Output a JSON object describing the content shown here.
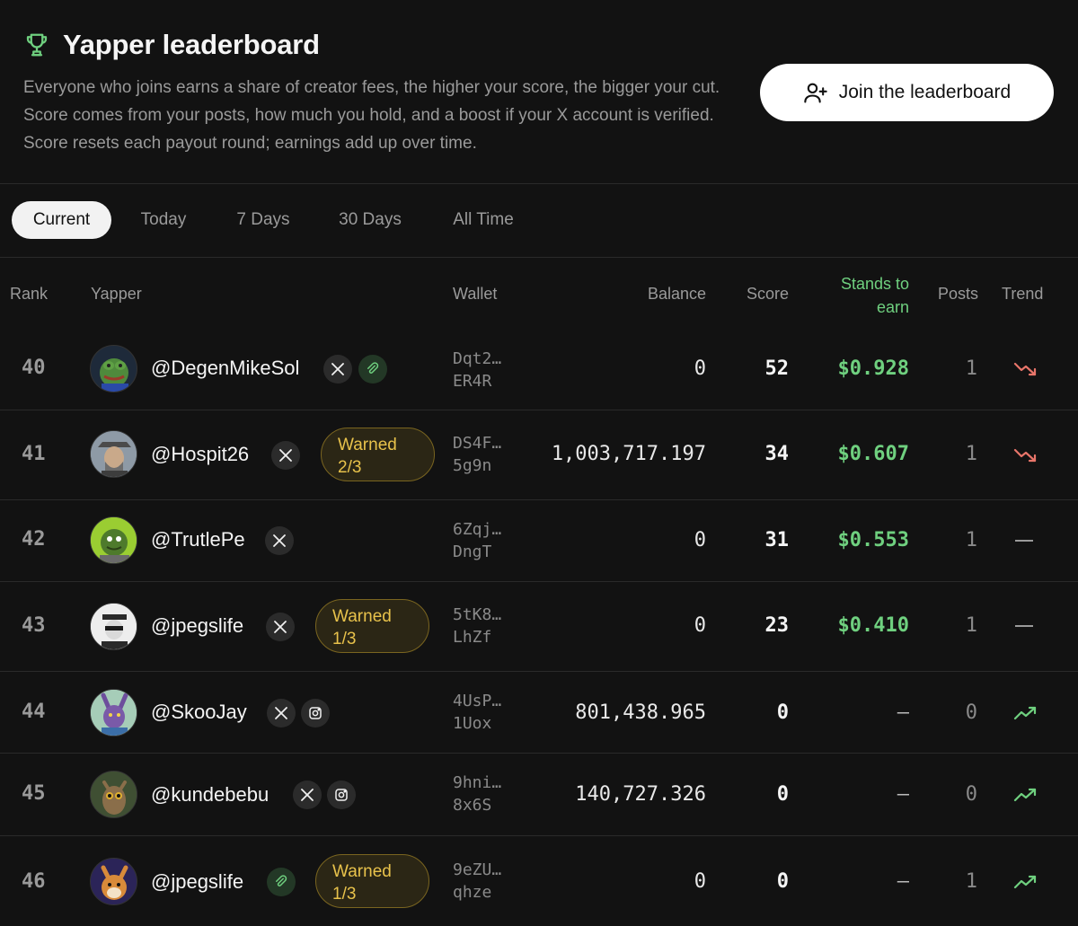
{
  "header": {
    "title": "Yapper leaderboard",
    "description": "Everyone who joins earns a share of creator fees, the higher your score, the bigger your cut. Score comes from your posts, how much you hold, and a boost if your X account is verified. Score resets each payout round; earnings add up over time.",
    "join_label": "Join the leaderboard",
    "trophy_icon": "trophy-icon",
    "accent": "#6fd07f"
  },
  "tabs": [
    "Current",
    "Today",
    "7 Days",
    "30 Days",
    "All Time"
  ],
  "active_tab": "Current",
  "columns": {
    "rank": "Rank",
    "yapper": "Yapper",
    "wallet": "Wallet",
    "balance": "Balance",
    "score": "Score",
    "stands_to_earn_1": "Stands to",
    "stands_to_earn_2": "earn",
    "posts": "Posts",
    "trend": "Trend"
  },
  "rows": [
    {
      "rank": "40",
      "handle": "@DegenMikeSol",
      "wallet_1": "Dqt2…",
      "wallet_2": "ER4R",
      "balance": "0",
      "score": "52",
      "earn": "$0.928",
      "posts": "1",
      "trend": "down",
      "badges": [
        "x",
        "link"
      ]
    },
    {
      "rank": "41",
      "handle": "@Hospit26",
      "wallet_1": "DS4F…",
      "wallet_2": "5g9n",
      "balance": "1,003,717.197",
      "score": "34",
      "earn": "$0.607",
      "posts": "1",
      "trend": "down",
      "badges": [
        "x"
      ],
      "warn_1": "Warned",
      "warn_2": "2/3"
    },
    {
      "rank": "42",
      "handle": "@TrutlePe",
      "wallet_1": "6Zqj…",
      "wallet_2": "DngT",
      "balance": "0",
      "score": "31",
      "earn": "$0.553",
      "posts": "1",
      "trend": "flat",
      "badges": [
        "x"
      ]
    },
    {
      "rank": "43",
      "handle": "@jpegslife",
      "wallet_1": "5tK8…",
      "wallet_2": "LhZf",
      "balance": "0",
      "score": "23",
      "earn": "$0.410",
      "posts": "1",
      "trend": "flat",
      "badges": [
        "x"
      ],
      "warn_1": "Warned",
      "warn_2": "1/3"
    },
    {
      "rank": "44",
      "handle": "@SkooJay",
      "wallet_1": "4UsP…",
      "wallet_2": "1Uox",
      "balance": "801,438.965",
      "score": "0",
      "earn": "—",
      "posts": "0",
      "trend": "up",
      "badges": [
        "x",
        "instagram"
      ]
    },
    {
      "rank": "45",
      "handle": "@kundebebu",
      "wallet_1": "9hni…",
      "wallet_2": "8x6S",
      "balance": "140,727.326",
      "score": "0",
      "earn": "—",
      "posts": "0",
      "trend": "up",
      "badges": [
        "x",
        "instagram"
      ]
    },
    {
      "rank": "46",
      "handle": "@jpegslife",
      "wallet_1": "9eZU…",
      "wallet_2": "qhze",
      "balance": "0",
      "score": "0",
      "earn": "—",
      "posts": "1",
      "trend": "up",
      "badges": [
        "link"
      ],
      "warn_1": "Warned",
      "warn_2": "1/3"
    }
  ],
  "icons": {
    "x": "x-logo-icon",
    "link": "link-icon",
    "instagram": "instagram-icon",
    "trend_down": "trending-down-icon",
    "trend_up": "trending-up-icon",
    "trend_flat": "dash-icon",
    "add_user": "add-user-icon"
  },
  "colors": {
    "up": "#6fd07f",
    "down": "#e8756a",
    "warn": "#e8c24b"
  }
}
